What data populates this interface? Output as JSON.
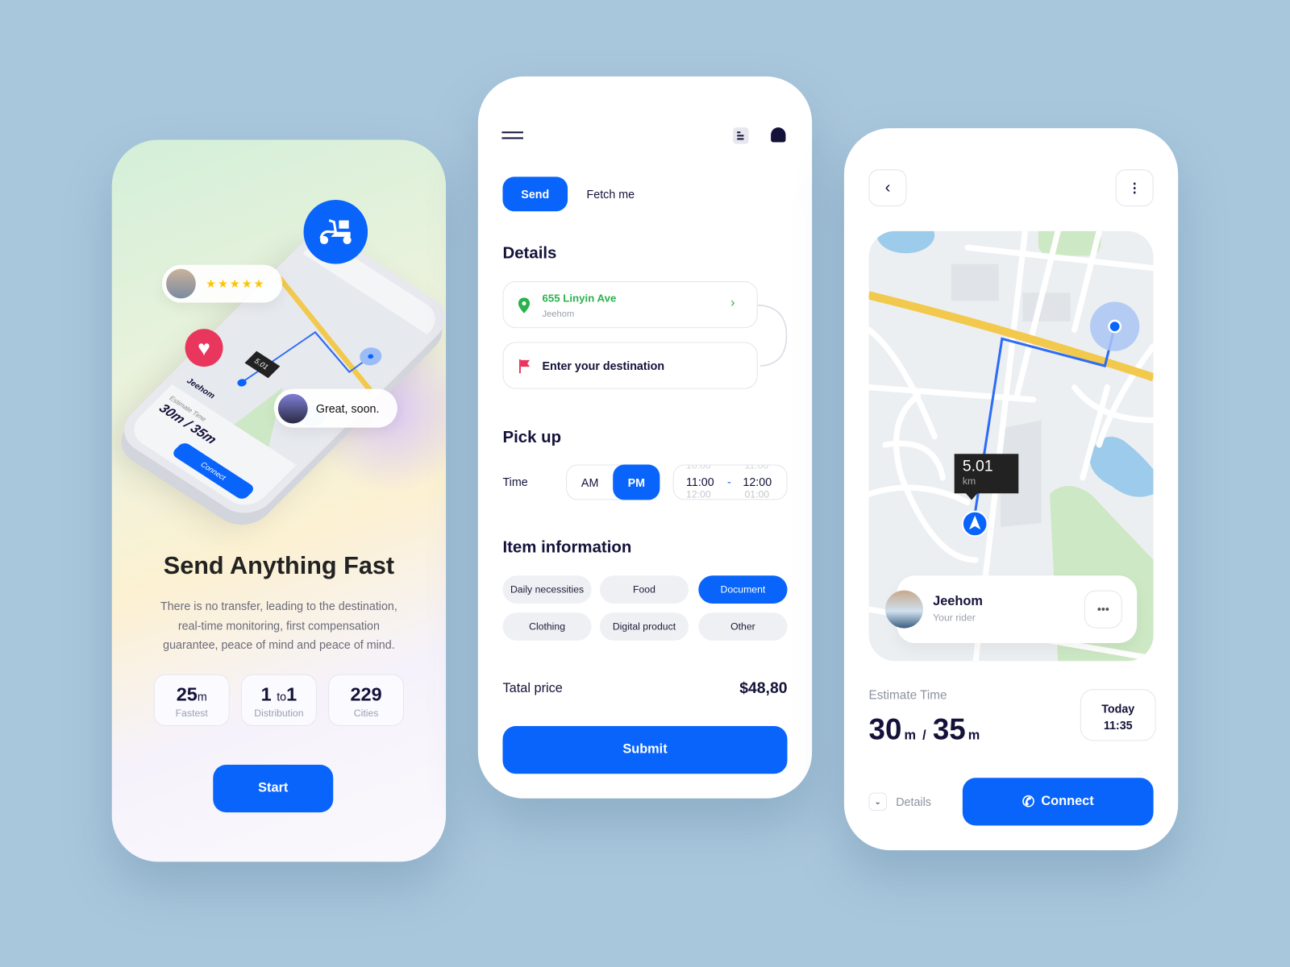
{
  "colors": {
    "accent": "#0864fb",
    "background": "#a9c7dc",
    "route_yellow": "#f2c94c",
    "pin_green": "#2bb24c",
    "flag_red": "#e8365d"
  },
  "onboarding": {
    "illustration": {
      "rating_stars": 5,
      "chat_message": "Great, soon.",
      "distance": "5.01",
      "rider_name": "Jeehom",
      "rider_role": "Your rider",
      "estimate_label": "Estimate Time",
      "estimate": "30m / 35m",
      "today": "Today",
      "time": "11:35",
      "details": "Details",
      "connect": "Connect"
    },
    "title": "Send Anything Fast",
    "description": "There is no transfer, leading to the destination, real-time monitoring, first compensation guarantee, peace of mind and peace of mind.",
    "stats": [
      {
        "value": "25",
        "unit": "m",
        "label": "Fastest"
      },
      {
        "value": "1",
        "unit": "to",
        "value2": "1",
        "label": "Distribution"
      },
      {
        "value": "229",
        "unit": "",
        "label": "Cities"
      }
    ],
    "start_label": "Start"
  },
  "order": {
    "tabs": [
      {
        "label": "Send",
        "active": true
      },
      {
        "label": "Fetch me",
        "active": false
      }
    ],
    "details_title": "Details",
    "origin": {
      "address": "655 Linyin Ave",
      "name": "Jeehom"
    },
    "destination_placeholder": "Enter your destination",
    "pickup_title": "Pick up",
    "time_label": "Time",
    "meridiem": {
      "options": [
        "AM",
        "PM"
      ],
      "selected": "PM"
    },
    "time_range": {
      "from": "11:00",
      "to": "12:00",
      "separator": "-",
      "prev_from": "10:00",
      "prev_to": "11:00",
      "next_from": "12:00",
      "next_to": "01:00"
    },
    "item_title": "Item information",
    "items": [
      {
        "label": "Daily necessities",
        "selected": false
      },
      {
        "label": "Food",
        "selected": false
      },
      {
        "label": "Document",
        "selected": true
      },
      {
        "label": "Clothing",
        "selected": false
      },
      {
        "label": "Digital product",
        "selected": false
      },
      {
        "label": "Other",
        "selected": false
      }
    ],
    "price_label": "Tatal price",
    "price": "$48,80",
    "submit_label": "Submit"
  },
  "tracking": {
    "distance": {
      "value": "5.01",
      "unit": "km"
    },
    "rider": {
      "name": "Jeehom",
      "role": "Your rider"
    },
    "estimate_label": "Estimate Time",
    "estimate": {
      "min": "30",
      "max": "35",
      "unit": "m",
      "separator": "/"
    },
    "date": {
      "day": "Today",
      "time": "11:35"
    },
    "details_label": "Details",
    "connect_label": "Connect"
  }
}
